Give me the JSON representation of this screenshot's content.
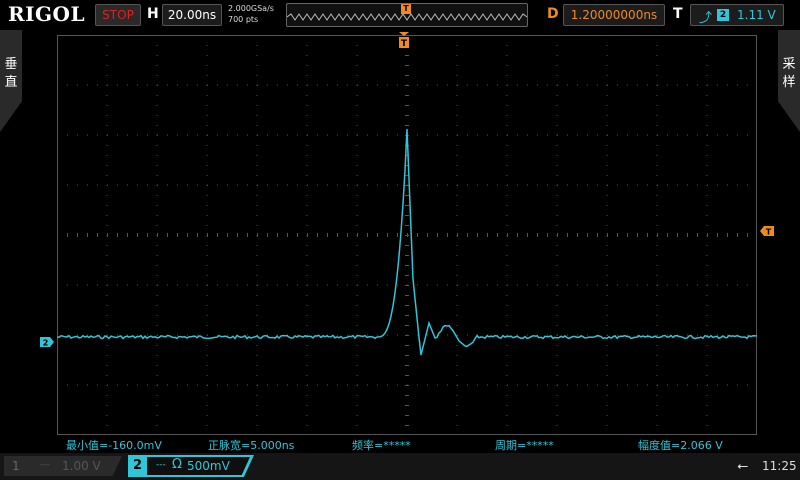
{
  "header": {
    "brand": "RIGOL",
    "run_state": "STOP",
    "h_label": "H",
    "timebase": "20.00ns",
    "sample_rate": "2.000GSa/s",
    "mem_depth": "700  pts",
    "trigger_pos_marker": "T",
    "d_label": "D",
    "delay": "1.20000000ns",
    "t_label": "T",
    "trigger_edge_icon": "rising-edge-icon",
    "trigger_source": "2",
    "trigger_level": "1.11 V"
  },
  "side": {
    "left_tab": [
      "垂",
      "直"
    ],
    "right_tab": [
      "采",
      "样"
    ]
  },
  "markers": {
    "trigger_top": "T",
    "trigger_level": "T",
    "ch2_ground": "2"
  },
  "measurements": [
    "最小值=-160.0mV",
    "正脉宽=5.000ns",
    "频率=*****",
    "周期=*****",
    "幅度值=2.066 V"
  ],
  "channels": {
    "ch1": {
      "num": "1",
      "coupling": "---",
      "scale": "1.00 V"
    },
    "ch2": {
      "num": "2",
      "coupling": "---",
      "impedance": "Ω",
      "scale": "500mV"
    }
  },
  "status": {
    "usb_icon": "usb-icon",
    "time": "11:25"
  },
  "colors": {
    "ch2": "#2ec6d8",
    "trigger": "#f08a1e",
    "stop": "#e02020"
  }
}
